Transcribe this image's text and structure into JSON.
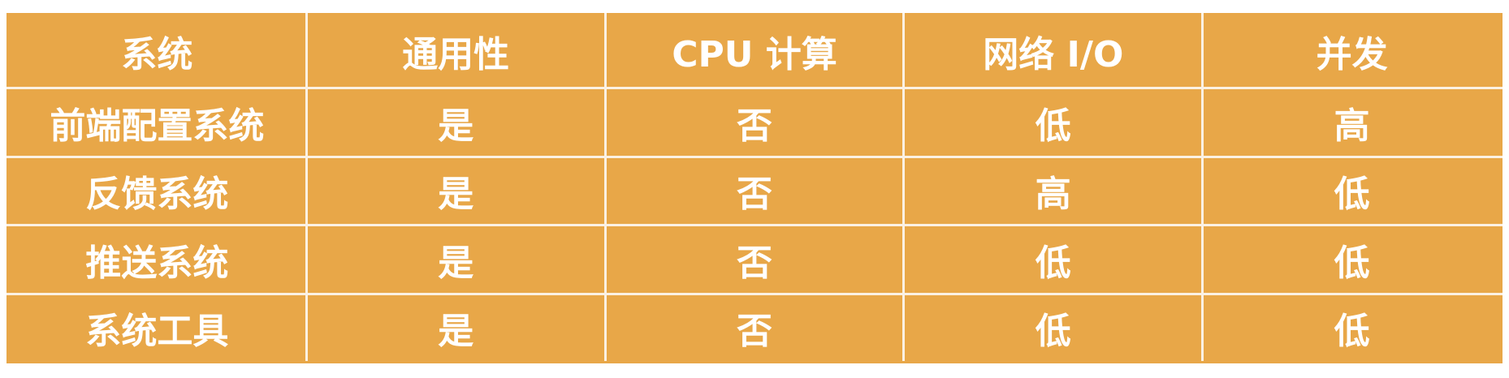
{
  "table": {
    "headers": [
      "系统",
      "通用性",
      "CPU 计算",
      "网络 I/O",
      "并发"
    ],
    "rows": [
      [
        "前端配置系统",
        "是",
        "否",
        "低",
        "高"
      ],
      [
        "反馈系统",
        "是",
        "否",
        "高",
        "低"
      ],
      [
        "推送系统",
        "是",
        "否",
        "低",
        "低"
      ],
      [
        "系统工具",
        "是",
        "否",
        "低",
        "低"
      ]
    ]
  },
  "colors": {
    "cell_background": "#E8A748",
    "grid_line": "#FBF1E3",
    "text": "#FFFFFF"
  }
}
